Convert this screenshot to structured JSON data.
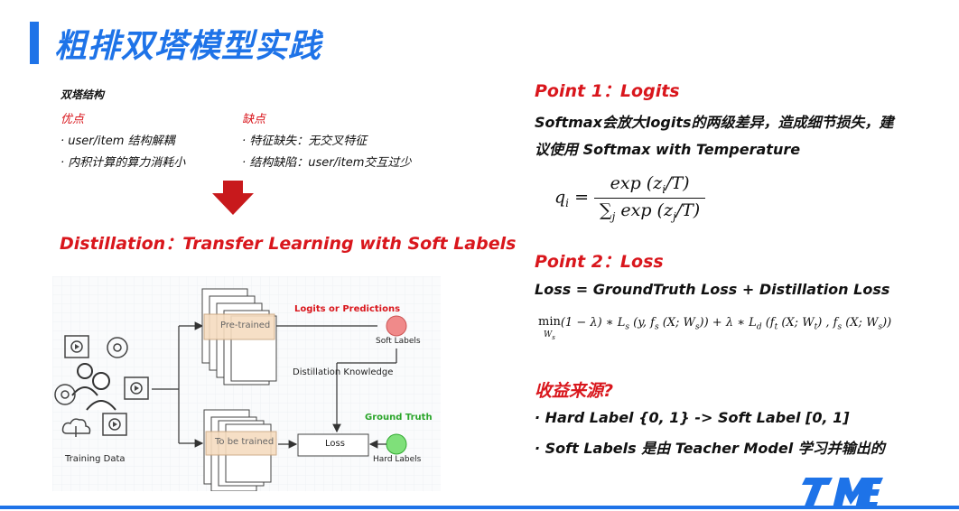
{
  "slide": {
    "title": "粗排双塔模型实践"
  },
  "left": {
    "structure_label": "双塔结构",
    "pros_title": "优点",
    "pros": [
      "· user/item 结构解耦",
      "· 内积计算的算力消耗小"
    ],
    "cons_title": "缺点",
    "cons": [
      "· 特征缺失：无交叉特征",
      "· 结构缺陷：user/item交互过少"
    ],
    "distillation_heading": "Distillation：Transfer Learning with Soft Labels"
  },
  "diagram": {
    "pretrained_label": "Pre-trained",
    "tobetrained_label": "To be trained",
    "logits_label": "Logits or Predictions",
    "soft_labels": "Soft Labels",
    "distill_knowledge": "Distillation Knowledge",
    "ground_truth": "Ground Truth",
    "loss_box": "Loss",
    "hard_labels": "Hard Labels",
    "training_data": "Training Data",
    "colors": {
      "red_circle": "#f08a8a",
      "green_circle": "#7fe07a",
      "orange_box": "#f6dcc0",
      "label_red": "#d9161c",
      "label_green": "#2aa52a"
    }
  },
  "right": {
    "point1_title": "Point 1：Logits",
    "point1_text_line1": "Softmax会放大logits的两级差异，造成细节损失，建",
    "point1_text_line2": "议使用 Softmax with Temperature",
    "eq1_lhs": "q",
    "eq1_lhs_sub": "i",
    "eq1_num": "exp (z",
    "eq1_num_sub": "i",
    "eq1_num_tail": "/T)",
    "eq1_den_sum": "∑",
    "eq1_den_sum_sub": "j",
    "eq1_den": " exp (z",
    "eq1_den_sub": "j",
    "eq1_den_tail": "/T)",
    "point2_title": "Point 2：Loss",
    "point2_text": "Loss = GroundTruth Loss + Distillation Loss",
    "eq2": "min(1 − λ) ∗ L_s (y, f_s (X; W_s)) + λ ∗ L_d (f_t (X; W_t) , f_s (X; W_s))",
    "eq2_parts": {
      "min": "min",
      "min_sub": "W",
      "min_sub2": "s",
      "a": "(1 − λ) ∗ L",
      "a_sub": "s",
      "b": " (y, f",
      "b_sub": "s",
      "c": " (X; W",
      "c_sub": "s",
      "d": ")) + λ ∗ L",
      "d_sub": "d",
      "e": " (f",
      "e_sub": "t",
      "f": " (X; W",
      "f_sub": "t",
      "g": ") , f",
      "g_sub": "s",
      "h": " (X; W",
      "h_sub": "s",
      "i": "))"
    },
    "gain_title": "收益来源?",
    "gain_items": [
      "· Hard Label {0, 1} -> Soft Label [0, 1]",
      "· Soft Labels 是由 Teacher Model 学习并输出的"
    ]
  },
  "logo": {
    "text": "TME",
    "color": "#1e73e8"
  }
}
